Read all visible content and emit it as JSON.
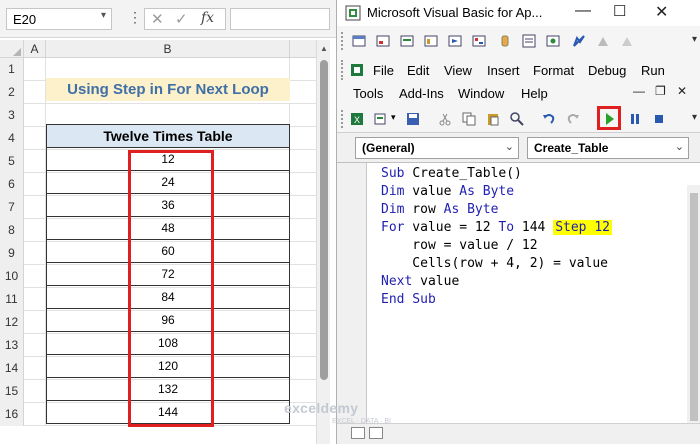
{
  "excel": {
    "name_box": "E20",
    "fx_symbol": "fx",
    "columns": [
      "A",
      "B"
    ],
    "rows": [
      "1",
      "2",
      "3",
      "4",
      "5",
      "6",
      "7",
      "8",
      "9",
      "10",
      "11",
      "12",
      "13",
      "14",
      "15",
      "16"
    ],
    "title": "Using Step in For Next Loop",
    "table_header": "Twelve Times Table",
    "values": [
      "12",
      "24",
      "36",
      "48",
      "60",
      "72",
      "84",
      "96",
      "108",
      "120",
      "132",
      "144"
    ]
  },
  "vba": {
    "window_title": "Microsoft Visual Basic for Ap...",
    "menu": [
      "File",
      "Edit",
      "View",
      "Insert",
      "Format",
      "Debug",
      "Run",
      "Tools",
      "Add-Ins",
      "Window",
      "Help"
    ],
    "object_combo": "(General)",
    "proc_combo": "Create_Table",
    "code_lines": [
      "Sub Create_Table()",
      "Dim value As Byte",
      "Dim row As Byte",
      "For value = 12 To 144 Step 12",
      "    row = value / 12",
      "    Cells(row + 4, 2) = value",
      "Next value",
      "End Sub"
    ],
    "highlight": "Step 12"
  },
  "watermark": {
    "brand": "exceldemy",
    "tagline": "EXCEL · DATA · BI"
  },
  "colors": {
    "title_fill": "#fdf1cb",
    "title_text": "#3e6fa6",
    "header_fill": "#dbe7f3",
    "annotation_red": "#e02020",
    "keyword_blue": "#1f1fb0",
    "highlight_yellow": "#ffff00"
  }
}
